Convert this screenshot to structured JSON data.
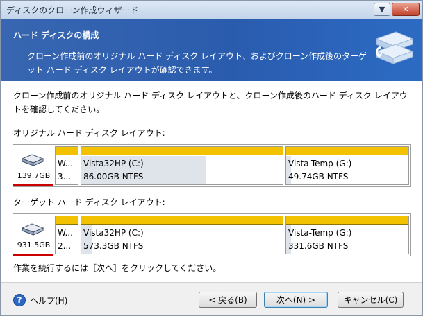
{
  "window": {
    "title": "ディスクのクローン作成ウィザード",
    "buttons": {
      "dropdown": "▼",
      "close": "✕"
    }
  },
  "header": {
    "title": "ハード ディスクの構成",
    "description": "クローン作成前のオリジナル ハード ディスク レイアウト、およびクローン作成後のターゲット ハード ディスク レイアウトが確認できます。"
  },
  "main": {
    "intro": "クローン作成前のオリジナル ハード ディスク レイアウトと、クローン作成後のハード ディスク レイアウトを確認してください。",
    "original_label": "オリジナル ハード ディスク レイアウト:",
    "target_label": "ターゲット ハード ディスク レイアウト:",
    "footer_note": "作業を続行するには［次へ］をクリックしてください。",
    "original_disk": {
      "size": "139.7GB",
      "partitions": [
        {
          "name": "W...",
          "detail": "3...",
          "used_fraction": 0.0
        },
        {
          "name": "Vista32HP (C:)",
          "detail": "86.00GB  NTFS",
          "used_fraction": 0.62
        },
        {
          "name": "Vista-Temp (G:)",
          "detail": "49.74GB  NTFS",
          "used_fraction": 0.04
        }
      ]
    },
    "target_disk": {
      "size": "931.5GB",
      "partitions": [
        {
          "name": "W...",
          "detail": "2...",
          "used_fraction": 0.0
        },
        {
          "name": "Vista32HP (C:)",
          "detail": "573.3GB  NTFS",
          "used_fraction": 0.05
        },
        {
          "name": "Vista-Temp (G:)",
          "detail": "331.6GB  NTFS",
          "used_fraction": 0.04
        }
      ]
    }
  },
  "bottom": {
    "help": "ヘルプ(H)",
    "back": "< 戻る(B)",
    "next": "次へ(N) >",
    "cancel": "キャンセル(C)"
  }
}
